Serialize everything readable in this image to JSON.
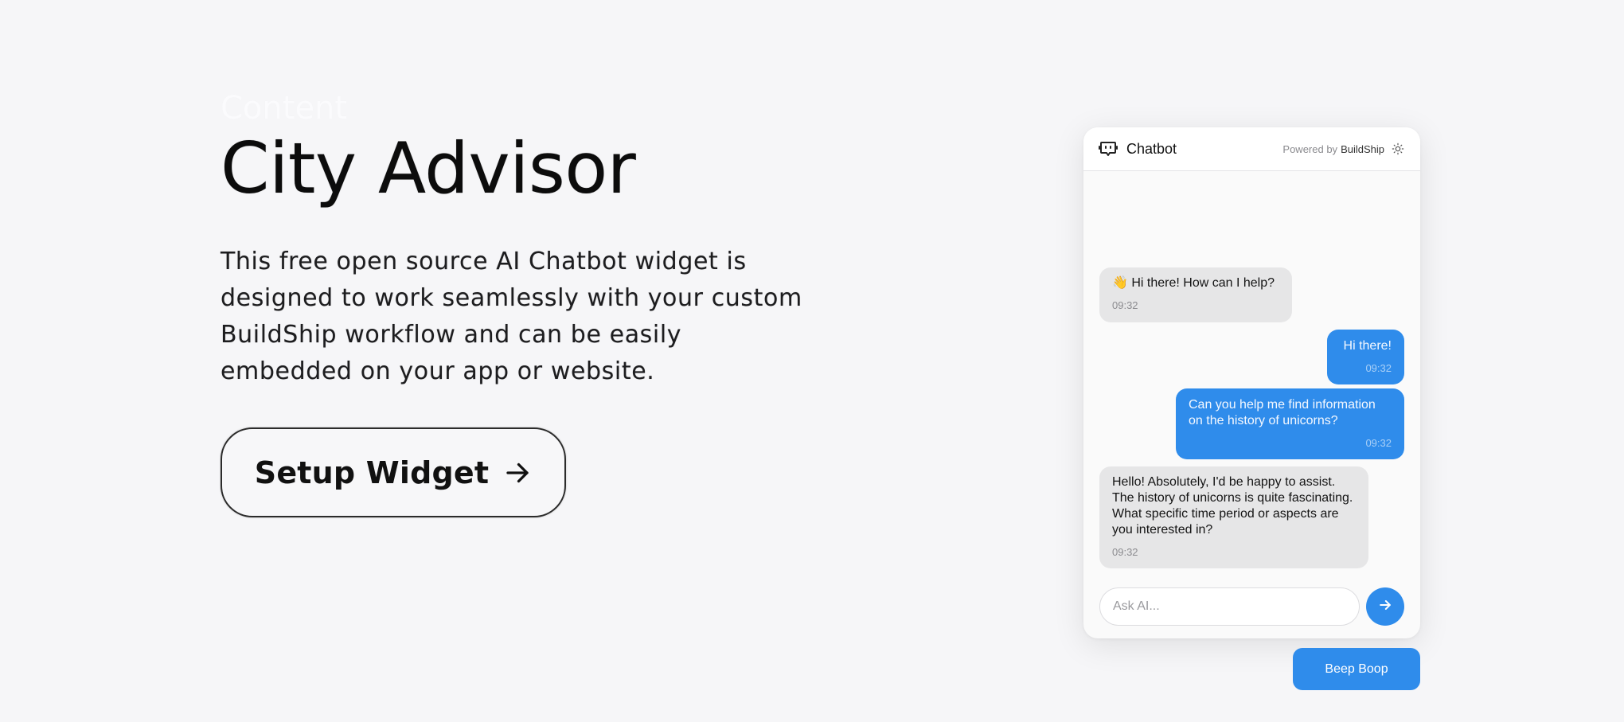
{
  "hero": {
    "ghost_label": "Content",
    "title": "City Advisor",
    "description": "This free open source AI Chatbot widget is designed to work seamlessly with your custom BuildShip workflow and can be easily embedded on your app or website.",
    "cta_label": "Setup Widget",
    "cta_icon": "arrow-right-icon"
  },
  "chat": {
    "title": "Chatbot",
    "powered_prefix": "Powered by",
    "powered_brand": "BuildShip",
    "header_icon": "bot-icon",
    "theme_icon": "sun-icon",
    "messages": [
      {
        "role": "bot",
        "text": "👋 Hi there! How can I help?",
        "time": "09:32"
      },
      {
        "role": "user",
        "text": "Hi there!",
        "time": "09:32"
      },
      {
        "role": "user",
        "text": "Can you help me find information on the history of unicorns?",
        "time": "09:32"
      },
      {
        "role": "bot",
        "text": "Hello! Absolutely, I'd be happy to assist. The history of unicorns is quite fascinating. What specific time period or aspects are you interested in?",
        "time": "09:32"
      }
    ],
    "input_placeholder": "Ask AI...",
    "send_icon": "arrow-right-icon"
  },
  "launcher": {
    "label": "Beep Boop"
  },
  "colors": {
    "background": "#f6f6f8",
    "accent": "#2f8ceb",
    "bot_bubble": "#e6e6e7"
  }
}
